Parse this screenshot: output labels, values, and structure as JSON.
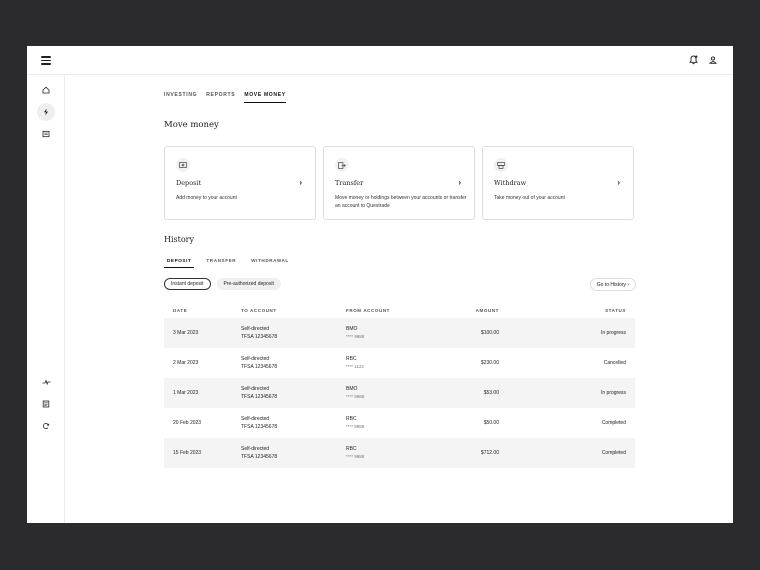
{
  "nav": {
    "tabs": [
      {
        "label": "INVESTING",
        "active": false
      },
      {
        "label": "REPORTS",
        "active": false
      },
      {
        "label": "MOVE MONEY",
        "active": true
      }
    ]
  },
  "page": {
    "title": "Move money"
  },
  "cards": [
    {
      "title": "Deposit",
      "description": "Add money to your account",
      "icon": "deposit-icon"
    },
    {
      "title": "Transfer",
      "description": "Move money or holdings between your accounts or transfer an account to Questrade",
      "icon": "transfer-icon"
    },
    {
      "title": "Withdraw",
      "description": "Take money out of your account",
      "icon": "withdraw-icon"
    }
  ],
  "history": {
    "title": "History",
    "tabs": [
      {
        "label": "DEPOSIT",
        "active": true
      },
      {
        "label": "TRANSFER",
        "active": false
      },
      {
        "label": "WITHDRAWAL",
        "active": false
      }
    ],
    "filters": [
      {
        "label": "Instant deposit",
        "active": true
      },
      {
        "label": "Pre-authorized deposit",
        "active": false
      }
    ],
    "go_to_history": "Go to History",
    "columns": [
      "DATE",
      "TO ACCOUNT",
      "FROM ACCOUNT",
      "AMOUNT",
      "STATUS"
    ],
    "rows": [
      {
        "date": "3 Mar 2023",
        "to_line1": "Self-directed",
        "to_line2": "TFSA 12345678",
        "from_bank": "BMO",
        "from_mask": "**** 9988",
        "amount": "$100.00",
        "status": "In progress"
      },
      {
        "date": "2 Mar 2023",
        "to_line1": "Self-directed",
        "to_line2": "TFSA 12345678",
        "from_bank": "RBC",
        "from_mask": "**** 1122",
        "amount": "$230.00",
        "status": "Cancelled"
      },
      {
        "date": "1 Mar 2023",
        "to_line1": "Self-directed",
        "to_line2": "TFSA 12345678",
        "from_bank": "BMO",
        "from_mask": "**** 9988",
        "amount": "$53.00",
        "status": "In progress"
      },
      {
        "date": "20 Feb 2023",
        "to_line1": "Self-directed",
        "to_line2": "TFSA 12345678",
        "from_bank": "RBC",
        "from_mask": "**** 9988",
        "amount": "$50.00",
        "status": "Completed"
      },
      {
        "date": "15 Feb 2023",
        "to_line1": "Self-directed",
        "to_line2": "TFSA 12345678",
        "from_bank": "RBC",
        "from_mask": "**** 9988",
        "amount": "$712.00",
        "status": "Completed"
      }
    ]
  },
  "colors": {
    "backdrop": "#2b2b2e",
    "surface": "#ffffff",
    "row_shade": "#f4f4f4",
    "text": "#1d1d1f"
  }
}
